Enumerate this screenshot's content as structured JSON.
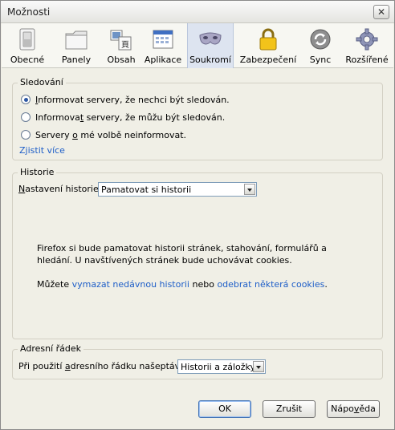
{
  "window": {
    "title": "Možnosti",
    "close_glyph": "✕"
  },
  "tabs": [
    {
      "label": "Obecné",
      "icon": "switch-icon"
    },
    {
      "label": "Panely",
      "icon": "folder-icon"
    },
    {
      "label": "Obsah",
      "icon": "content-icon"
    },
    {
      "label": "Aplikace",
      "icon": "applications-icon"
    },
    {
      "label": "Soukromí",
      "icon": "mask-icon",
      "selected": true
    },
    {
      "label": "Zabezpečení",
      "icon": "lock-icon"
    },
    {
      "label": "Sync",
      "icon": "sync-icon"
    },
    {
      "label": "Rozšířené",
      "icon": "gear-icon"
    }
  ],
  "tracking": {
    "legend": "Sledování",
    "options": [
      {
        "pre": "",
        "accel": "I",
        "post": "nformovat servery, že nechci být sledován.",
        "checked": true
      },
      {
        "pre": "Informova",
        "accel": "t",
        "post": " servery, že můžu být sledován.",
        "checked": false
      },
      {
        "pre": "Servery ",
        "accel": "o",
        "post": " mé volbě neinformovat.",
        "checked": false
      }
    ],
    "learn_more": "Zjistit více"
  },
  "history": {
    "legend": "Historie",
    "setting_label_accel": "N",
    "setting_label_rest": "astavení historie:",
    "setting_value": "Pamatovat si historii",
    "description": "Firefox si bude pamatovat historii stránek, stahování, formulářů a hledání. U navštívených stránek bude uchovávat cookies.",
    "clear_pre": "Můžete ",
    "clear_link": "vymazat nedávnou historii",
    "clear_mid": " nebo ",
    "remove_link": "odebrat některá cookies",
    "clear_post": "."
  },
  "location_bar": {
    "legend": "Adresní řádek",
    "label_pre": "Při použití ",
    "label_accel": "a",
    "label_post": "dresního řádku našeptávat:",
    "value": "Historii a záložky"
  },
  "buttons": {
    "ok": "OK",
    "cancel": "Zrušit",
    "help_pre": "Nápo",
    "help_accel": "v",
    "help_post": "ěda"
  },
  "colors": {
    "accent": "#2c56a4",
    "link": "#1e5ec8",
    "selected_tab": "#dde4f0"
  }
}
